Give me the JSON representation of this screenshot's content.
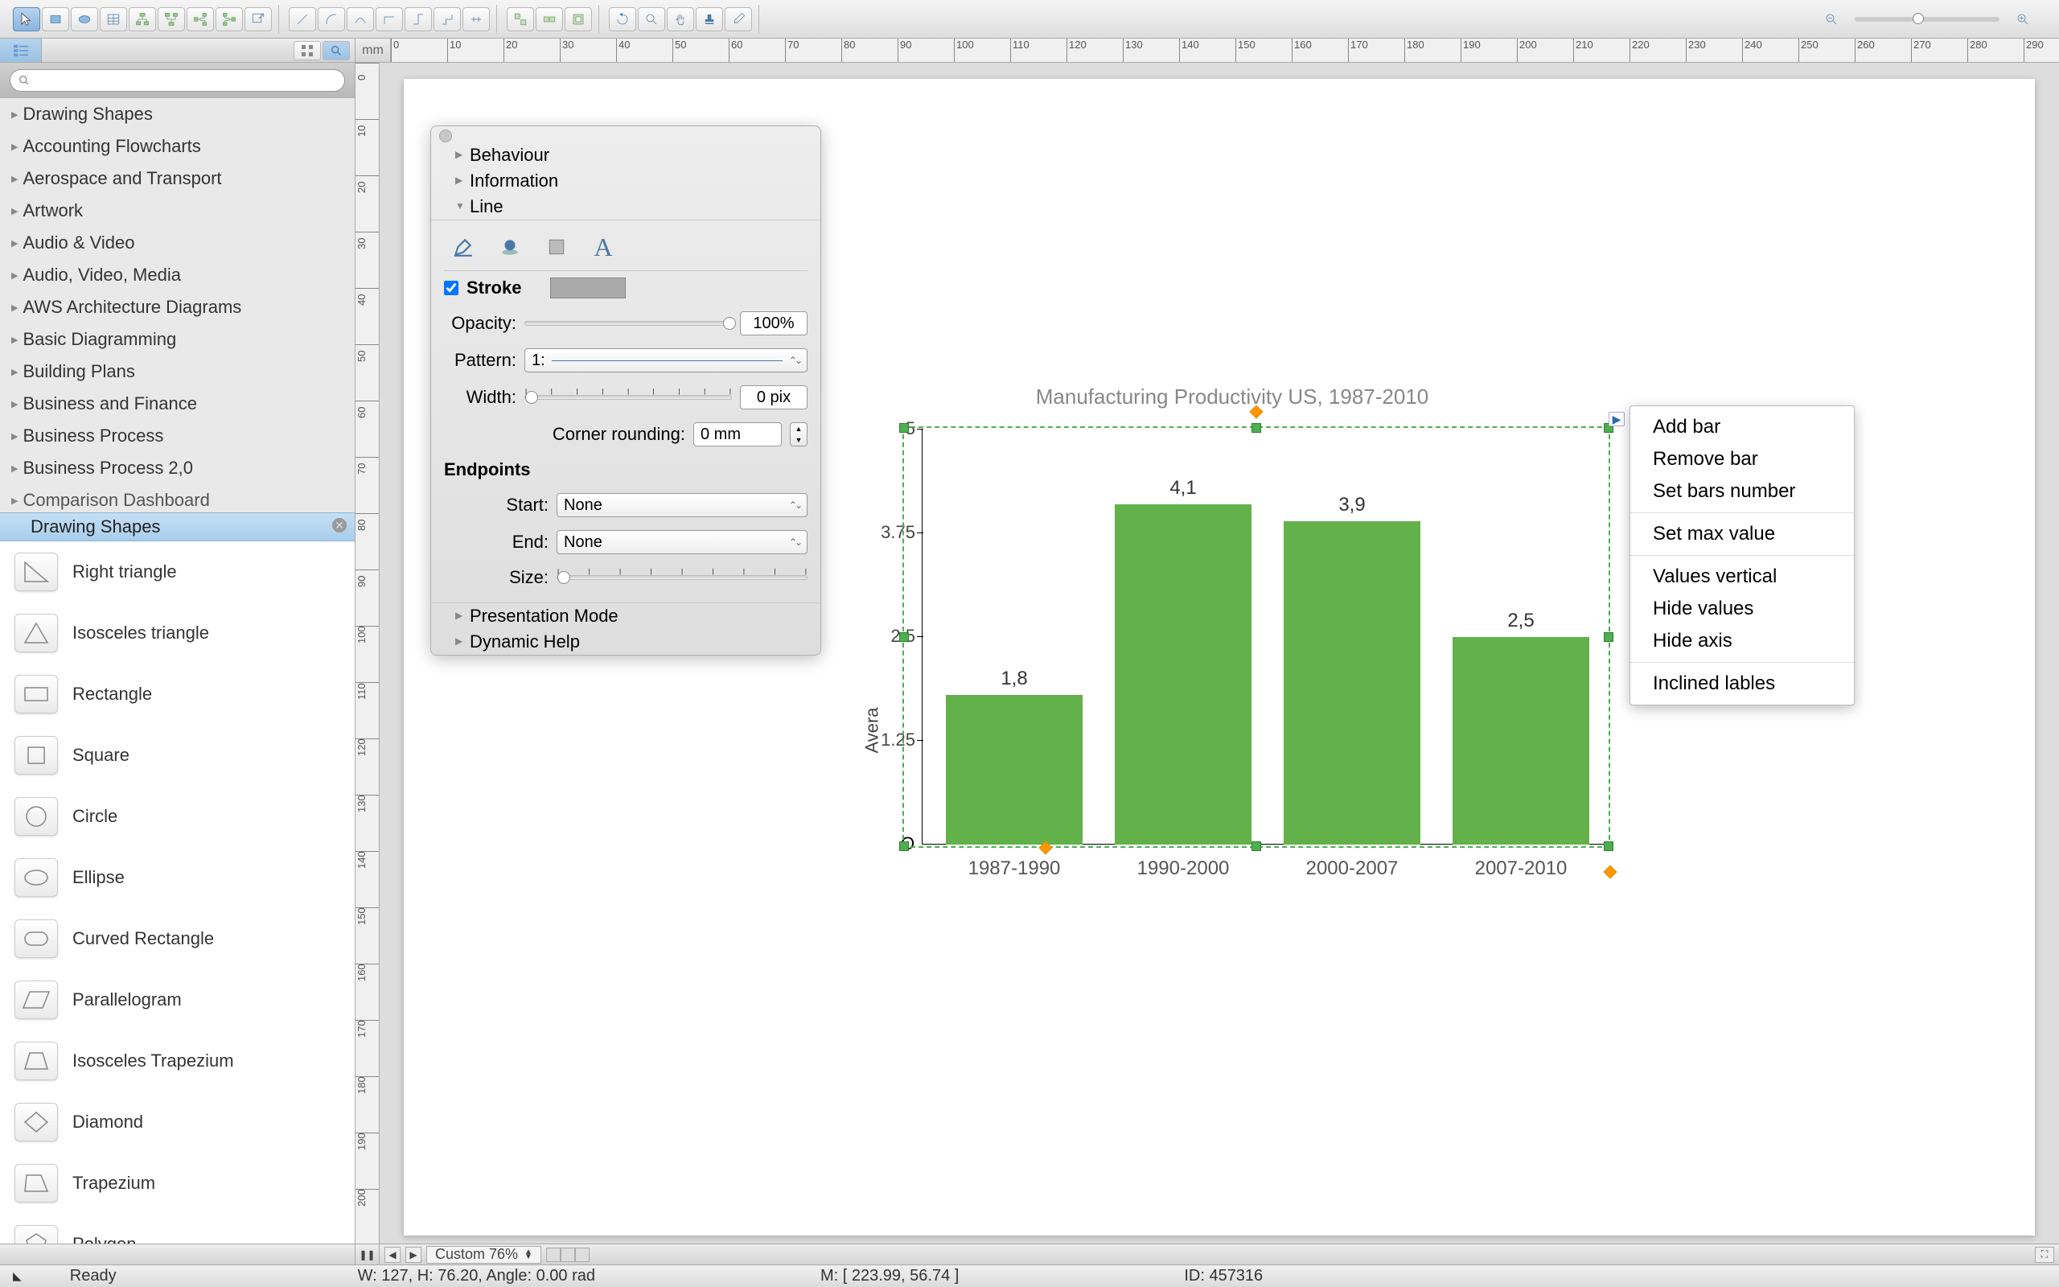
{
  "toolbar": {
    "groups": [
      [
        "pointer",
        "rectangle-shape",
        "ellipse-shape",
        "table",
        "org-left",
        "org-right",
        "org-rev",
        "org-flip",
        "export"
      ],
      [
        "conn-straight",
        "conn-curve",
        "conn-arc",
        "conn-multi",
        "conn-double",
        "conn-bezier",
        "conn-bracket"
      ],
      [
        "align-left",
        "align-center",
        "align-right"
      ],
      [
        "refresh",
        "zoom-tool",
        "pan-tool",
        "highlight",
        "eyedropper"
      ]
    ]
  },
  "ruler_unit": "mm",
  "library": {
    "search_placeholder": "",
    "categories": [
      "Drawing Shapes",
      "Accounting Flowcharts",
      "Aerospace and Transport",
      "Artwork",
      "Audio & Video",
      "Audio, Video, Media",
      "AWS Architecture Diagrams",
      "Basic Diagramming",
      "Building Plans",
      "Business and Finance",
      "Business Process",
      "Business Process 2,0",
      "Comparison Dashboard"
    ],
    "open_section": "Drawing Shapes",
    "shapes": [
      "Right triangle",
      "Isosceles triangle",
      "Rectangle",
      "Square",
      "Circle",
      "Ellipse",
      "Curved Rectangle",
      "Parallelogram",
      "Isosceles Trapezium",
      "Diamond",
      "Trapezium",
      "Polygon"
    ]
  },
  "inspector": {
    "sections": {
      "behaviour": "Behaviour",
      "information": "Information",
      "line": "Line",
      "presentation": "Presentation Mode",
      "dynamic_help": "Dynamic Help"
    },
    "stroke_label": "Stroke",
    "opacity_label": "Opacity:",
    "opacity_value": "100%",
    "pattern_label": "Pattern:",
    "pattern_value": "1:",
    "width_label": "Width:",
    "width_value": "0 pix",
    "corner_label": "Corner rounding:",
    "corner_value": "0 mm",
    "endpoints_label": "Endpoints",
    "start_label": "Start:",
    "start_value": "None",
    "end_label": "End:",
    "end_value": "None",
    "size_label": "Size:"
  },
  "chart_data": {
    "type": "bar",
    "title": "Manufacturing Productivity US, 1987-2010",
    "ylabel": "Avera",
    "categories": [
      "1987-1990",
      "1990-2000",
      "2000-2007",
      "2007-2010"
    ],
    "values": [
      1.8,
      4.1,
      3.9,
      2.5
    ],
    "value_labels": [
      "1,8",
      "4,1",
      "3,9",
      "2,5"
    ],
    "y_ticks": [
      0,
      1.25,
      2.5,
      3.75,
      5
    ],
    "y_tick_labels": [
      "O",
      "1.25",
      "2.5",
      "3.75",
      "5"
    ],
    "ylim": [
      0,
      5
    ]
  },
  "context_menu": {
    "items": [
      "Add bar",
      "Remove bar",
      "Set bars number",
      "---",
      "Set max value",
      "---",
      "Values vertical",
      "Hide values",
      "Hide axis",
      "---",
      "Inclined lables"
    ]
  },
  "bottom": {
    "zoom": "Custom 76%"
  },
  "status": {
    "ready": "Ready",
    "dims": "W: 127,  H: 76.20,  Angle: 0.00 rad",
    "mouse": "M: [ 223.99, 56.74 ]",
    "id": "ID: 457316"
  },
  "ruler_ticks_h": [
    0,
    10,
    20,
    30,
    40,
    50,
    60,
    70,
    80,
    90,
    100,
    110,
    120,
    130,
    140,
    150,
    160,
    170,
    180,
    190,
    200,
    210,
    220,
    230,
    240,
    250,
    260,
    270,
    280,
    290
  ],
  "ruler_ticks_v": [
    0,
    10,
    20,
    30,
    40,
    50,
    60,
    70,
    80,
    90,
    100,
    110,
    120,
    130,
    140,
    150,
    160,
    170,
    180,
    190,
    200
  ]
}
